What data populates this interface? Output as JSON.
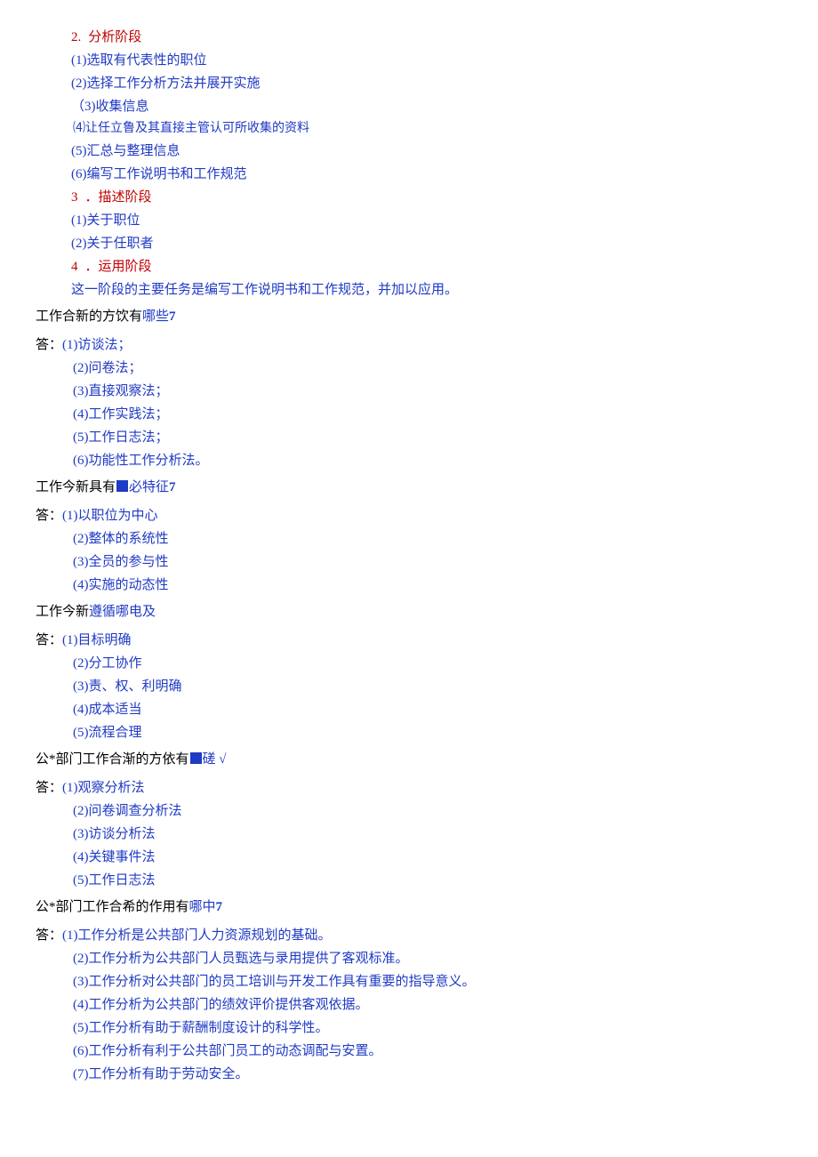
{
  "section1": {
    "h2": {
      "num": "2.",
      "title": "分析阶段"
    },
    "items": [
      "(1)选取有代表性的职位",
      "(2)选择工作分析方法并展开实施",
      "（3)收集信息",
      "⑷让任立鲁及其直接主管认可所收集的资料",
      "(5)汇总与整理信息",
      "(6)编写工作说明书和工作规范"
    ],
    "h3": {
      "num": "3",
      "title": "．描述阶段"
    },
    "items3": [
      "(1)关于职位",
      "(2)关于任职者"
    ],
    "h4": {
      "num": "4",
      "title": "．运用阶段"
    },
    "para4": "这一阶段的主要任务是编写工作说明书和工作规范，并加以应用。"
  },
  "q1": {
    "question_pre": "工作合新的方饮有",
    "question_blue": "哪些",
    "question_num": "7",
    "answers": [
      "(1)访谈法；",
      "(2)问卷法；",
      "(3)直接观察法；",
      "(4)工作实践法；",
      "(5)工作日志法；",
      "(6)功能性工作分析法。"
    ]
  },
  "q2": {
    "question_pre": "工作今新具有",
    "question_blue": "必特征",
    "question_num": "7",
    "answers": [
      "(1)以职位为中心",
      "(2)整体的系统性",
      "(3)全员的参与性",
      "(4)实施的动态性"
    ]
  },
  "q3": {
    "question_pre": "工作今新",
    "question_blue": "遵循哪电及",
    "answers": [
      "(1)目标明确",
      "(2)分工协作",
      "(3)责、权、利明确",
      "(4)成本适当",
      "(5)流程合理"
    ]
  },
  "q4": {
    "question_pre": "公*部门工作合渐的方依有",
    "question_blue": "磋",
    "check": "√",
    "answers": [
      "(1)观察分析法",
      "(2)问卷调查分析法",
      "(3)访谈分析法",
      "(4)关键事件法",
      "(5)工作日志法"
    ]
  },
  "q5": {
    "question_pre": "公*部门工作合希的作用有",
    "question_blue": "哪中",
    "question_num": "7",
    "answers": [
      "(1)工作分析是公共部门人力资源规划的基础。",
      "(2)工作分析为公共部门人员甄选与录用提供了客观标准。",
      "(3)工作分析对公共部门的员工培训与开发工作具有重要的指导意义。",
      "(4)工作分析为公共部门的绩效评价提供客观依据。",
      "(5)工作分析有助于薪酬制度设计的科学性。",
      "(6)工作分析有利于公共部门员工的动态调配与安置。",
      "(7)工作分析有助于劳动安全。"
    ]
  },
  "ans_label": "答："
}
